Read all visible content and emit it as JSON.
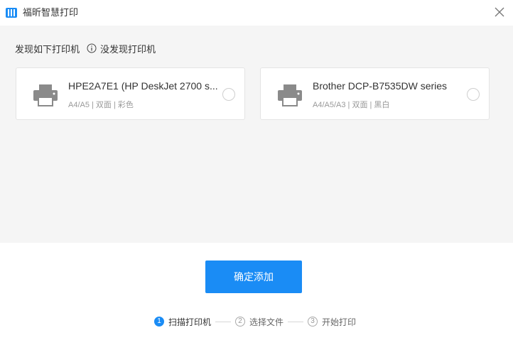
{
  "app": {
    "title": "福昕智慧打印"
  },
  "content": {
    "found_label": "发现如下打印机",
    "help_label": "没发现打印机"
  },
  "printers": [
    {
      "name": "HPE2A7E1 (HP DeskJet 2700 s...",
      "specs": "A4/A5 | 双面 | 彩色",
      "selected": false
    },
    {
      "name": "Brother DCP-B7535DW series",
      "specs": "A4/A5/A3 | 双面 | 黑白",
      "selected": false
    }
  ],
  "actions": {
    "confirm_label": "确定添加"
  },
  "steps": [
    {
      "number": "1",
      "label": "扫描打印机",
      "active": true
    },
    {
      "number": "2",
      "label": "选择文件",
      "active": false
    },
    {
      "number": "3",
      "label": "开始打印",
      "active": false
    }
  ],
  "colors": {
    "accent": "#1a8cf5",
    "content_bg": "#f5f5f5"
  },
  "icons": {
    "logo": "app-logo-icon",
    "close": "close-icon",
    "info": "info-icon",
    "printer": "printer-icon"
  }
}
